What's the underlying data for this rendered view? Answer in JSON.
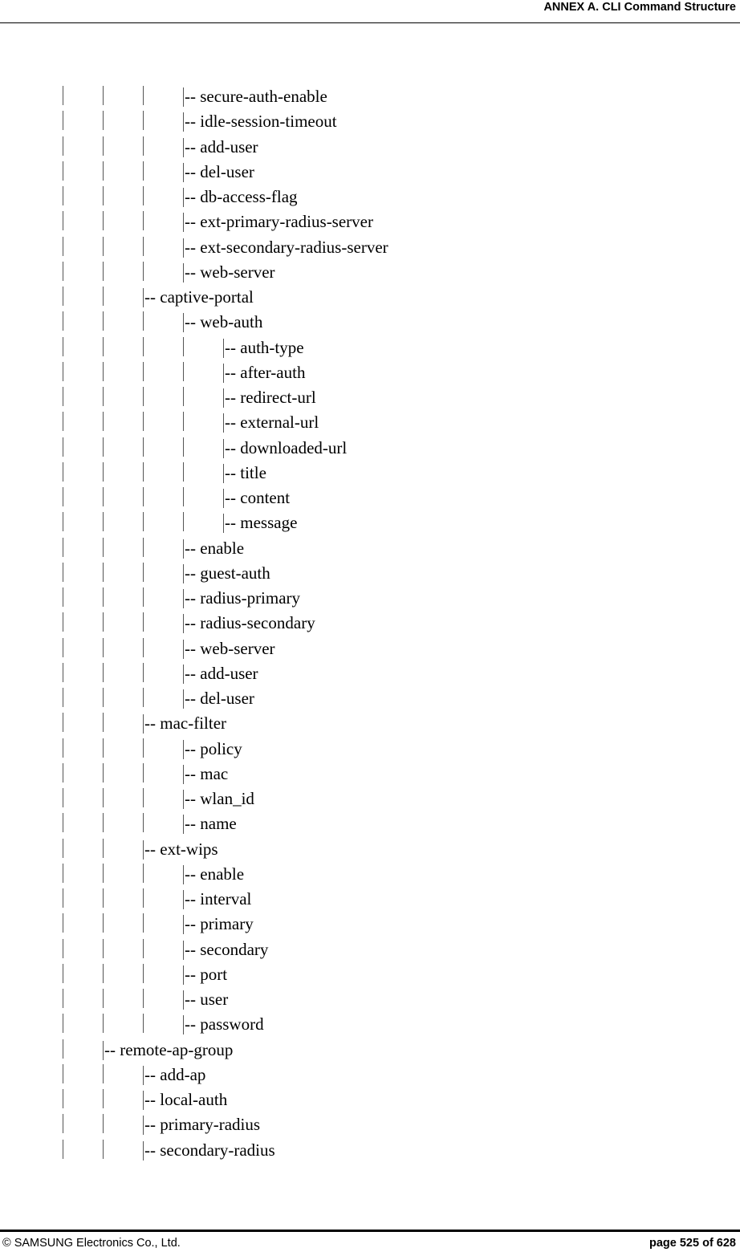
{
  "header": {
    "title": "ANNEX A. CLI Command Structure"
  },
  "tree": {
    "connector": "-- ",
    "lines": [
      {
        "depth": 3,
        "label": "secure-auth-enable"
      },
      {
        "depth": 3,
        "label": "idle-session-timeout"
      },
      {
        "depth": 3,
        "label": "add-user"
      },
      {
        "depth": 3,
        "label": "del-user"
      },
      {
        "depth": 3,
        "label": "db-access-flag"
      },
      {
        "depth": 3,
        "label": "ext-primary-radius-server"
      },
      {
        "depth": 3,
        "label": "ext-secondary-radius-server"
      },
      {
        "depth": 3,
        "label": "web-server"
      },
      {
        "depth": 2,
        "label": "captive-portal"
      },
      {
        "depth": 3,
        "label": "web-auth"
      },
      {
        "depth": 4,
        "label": "auth-type"
      },
      {
        "depth": 4,
        "label": "after-auth"
      },
      {
        "depth": 4,
        "label": "redirect-url"
      },
      {
        "depth": 4,
        "label": "external-url"
      },
      {
        "depth": 4,
        "label": "downloaded-url"
      },
      {
        "depth": 4,
        "label": "title"
      },
      {
        "depth": 4,
        "label": "content"
      },
      {
        "depth": 4,
        "label": "message"
      },
      {
        "depth": 3,
        "label": "enable"
      },
      {
        "depth": 3,
        "label": "guest-auth"
      },
      {
        "depth": 3,
        "label": "radius-primary"
      },
      {
        "depth": 3,
        "label": "radius-secondary"
      },
      {
        "depth": 3,
        "label": "web-server"
      },
      {
        "depth": 3,
        "label": "add-user"
      },
      {
        "depth": 3,
        "label": "del-user"
      },
      {
        "depth": 2,
        "label": "mac-filter"
      },
      {
        "depth": 3,
        "label": "policy"
      },
      {
        "depth": 3,
        "label": "mac"
      },
      {
        "depth": 3,
        "label": "wlan_id"
      },
      {
        "depth": 3,
        "label": "name"
      },
      {
        "depth": 2,
        "label": "ext-wips"
      },
      {
        "depth": 3,
        "label": "enable"
      },
      {
        "depth": 3,
        "label": "interval"
      },
      {
        "depth": 3,
        "label": "primary"
      },
      {
        "depth": 3,
        "label": "secondary"
      },
      {
        "depth": 3,
        "label": "port"
      },
      {
        "depth": 3,
        "label": "user"
      },
      {
        "depth": 3,
        "label": "password"
      },
      {
        "depth": 1,
        "label": "remote-ap-group"
      },
      {
        "depth": 2,
        "label": "add-ap"
      },
      {
        "depth": 2,
        "label": "local-auth"
      },
      {
        "depth": 2,
        "label": "primary-radius"
      },
      {
        "depth": 2,
        "label": "secondary-radius"
      }
    ]
  },
  "footer": {
    "copyright": "© SAMSUNG Electronics Co., Ltd.",
    "page": "page 525 of 628"
  }
}
